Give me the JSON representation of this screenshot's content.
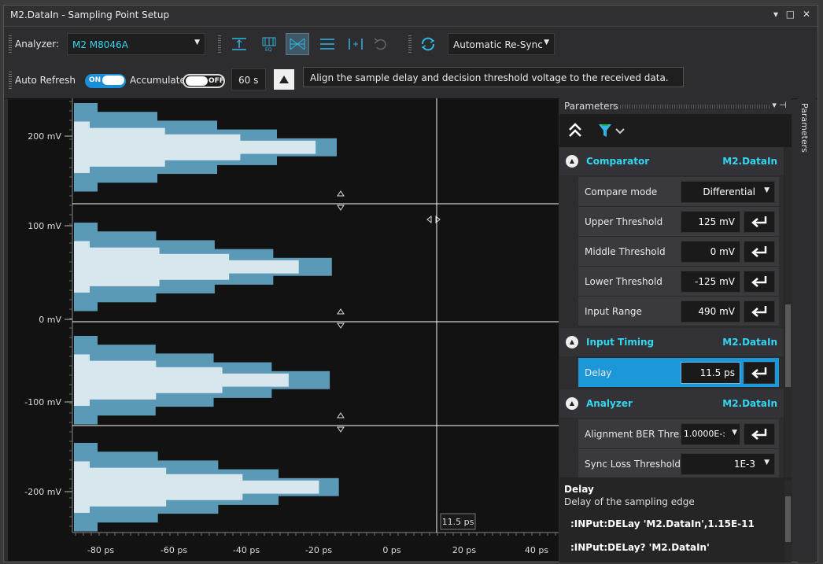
{
  "window": {
    "title": "M2.DataIn - Sampling Point Setup",
    "controls": "▾ □ ✕"
  },
  "toolbar1": {
    "analyzer_label": "Analyzer:",
    "analyzer_value": "M2 M8046A",
    "sync_mode": "Automatic  Re-Sync",
    "icons": [
      "align-delay-icon",
      "eq-icon",
      "align-both-icon",
      "align-threshold-icon",
      "center-delay-icon",
      "undo-icon",
      "resync-icon"
    ]
  },
  "toolbar2": {
    "auto_refresh_label": "Auto Refresh",
    "auto_refresh_state": "ON",
    "accumulate_label": "Accumulate",
    "accumulate_state": "OFF",
    "duration": "60 s"
  },
  "tooltip": "Align the sample delay and decision threshold voltage to the received data.",
  "plot": {
    "y_ticks": [
      "200 mV",
      "100 mV",
      "0 mV",
      "-100 mV",
      "-200 mV"
    ],
    "x_ticks": [
      "-80 ps",
      "-60 ps",
      "-40 ps",
      "-20 ps",
      "0 ps",
      "20 ps",
      "40 ps"
    ],
    "cursor_label": "11.5 ps",
    "colors": {
      "outer": "#5b9ab6",
      "inner": "#d8e7ee",
      "background": "#121212",
      "line": "#ffffff"
    }
  },
  "panel": {
    "title": "Parameters",
    "sidetab": "Parameters",
    "sections": [
      {
        "name": "Comparator",
        "device": "M2.DataIn"
      },
      {
        "name": "Input Timing",
        "device": "M2.DataIn"
      },
      {
        "name": "Analyzer",
        "device": "M2.DataIn"
      }
    ],
    "comparator": [
      {
        "name": "Compare mode",
        "value": "Differential"
      },
      {
        "name": "Upper Threshold",
        "value": "125 mV"
      },
      {
        "name": "Middle Threshold",
        "value": "0 mV"
      },
      {
        "name": "Lower Threshold",
        "value": "-125 mV"
      },
      {
        "name": "Input Range",
        "value": "490 mV"
      }
    ],
    "timing": [
      {
        "name": "Delay",
        "value": "11.5 ps"
      }
    ],
    "analyzer": [
      {
        "name": "Alignment BER Thre...",
        "value": "1.0000E-:"
      },
      {
        "name": "Sync Loss Threshold",
        "value": "1E-3"
      }
    ],
    "description": {
      "title": "Delay",
      "text": "Delay of the sampling edge",
      "cmd1": ":INPut:DELay 'M2.DataIn',1.15E-11",
      "cmd2": ":INPut:DELay? 'M2.DataIn'"
    }
  }
}
